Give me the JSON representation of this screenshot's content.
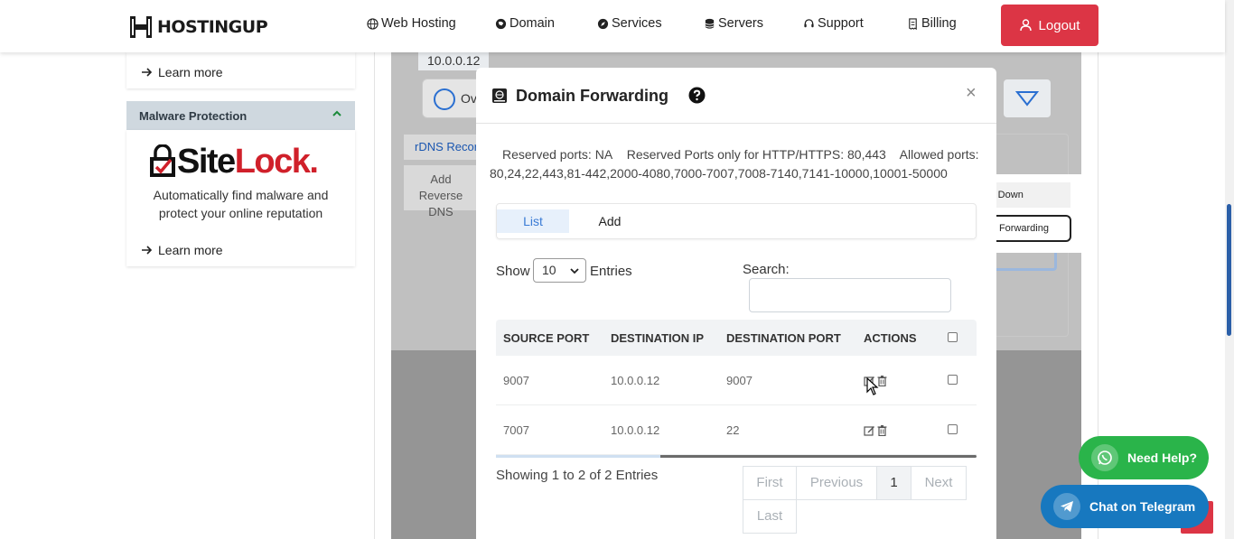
{
  "header": {
    "logo_text": "HOSTINGUP",
    "nav": [
      {
        "label": "Web Hosting",
        "icon": "globe-icon"
      },
      {
        "label": "Domain",
        "icon": "domain-icon"
      },
      {
        "label": "Services",
        "icon": "compass-icon"
      },
      {
        "label": "Servers",
        "icon": "database-icon"
      },
      {
        "label": "Support",
        "icon": "headset-icon"
      },
      {
        "label": "Billing",
        "icon": "receipt-icon"
      }
    ],
    "logout_label": "Logout",
    "colors": {
      "logout_bg": "#dc3545"
    }
  },
  "sidebar": {
    "learn_more_top": "Learn more",
    "malware_title": "Malware Protection",
    "sitelock_logo": {
      "site": "Site",
      "lock": "Lock",
      "dot": "."
    },
    "malware_desc": "Automatically find malware and protect your online reputation",
    "learn_more_bottom": "Learn more"
  },
  "background": {
    "ip_badge": "10.0.0.12",
    "overview_label": "Ov",
    "rdns_tab": "rDNS Records",
    "add_reverse": "Add Reverse DNS",
    "dropdown_item_1": "Shut Down",
    "dropdown_item_2": "Domain Forwarding"
  },
  "modal": {
    "title": "Domain Forwarding",
    "close": "×",
    "reserved_ports": "Reserved ports: NA",
    "reserved_http": "Reserved Ports only for HTTP/HTTPS: 80,443",
    "allowed_ports_label": "Allowed ports:",
    "allowed_ports": "80,24,22,443,81-442,2000-4080,7000-7007,7008-7140,7141-10000,10001-50000",
    "tabs": {
      "list": "List",
      "add": "Add"
    },
    "show_label": "Show",
    "show_value": "10",
    "entries_label": "Entries",
    "search_label": "Search:",
    "search_value": "",
    "table": {
      "headers": [
        "SOURCE PORT",
        "DESTINATION IP",
        "DESTINATION PORT",
        "ACTIONS"
      ],
      "rows": [
        {
          "source_port": "9007",
          "destination_ip": "10.0.0.12",
          "destination_port": "9007"
        },
        {
          "source_port": "7007",
          "destination_ip": "10.0.0.12",
          "destination_port": "22"
        }
      ]
    },
    "showing": "Showing 1 to 2 of 2 Entries",
    "pager": {
      "first": "First",
      "previous": "Previous",
      "current": "1",
      "next": "Next",
      "last": "Last"
    }
  },
  "floating": {
    "need_help": "Need Help?",
    "telegram": "Chat on Telegram"
  }
}
